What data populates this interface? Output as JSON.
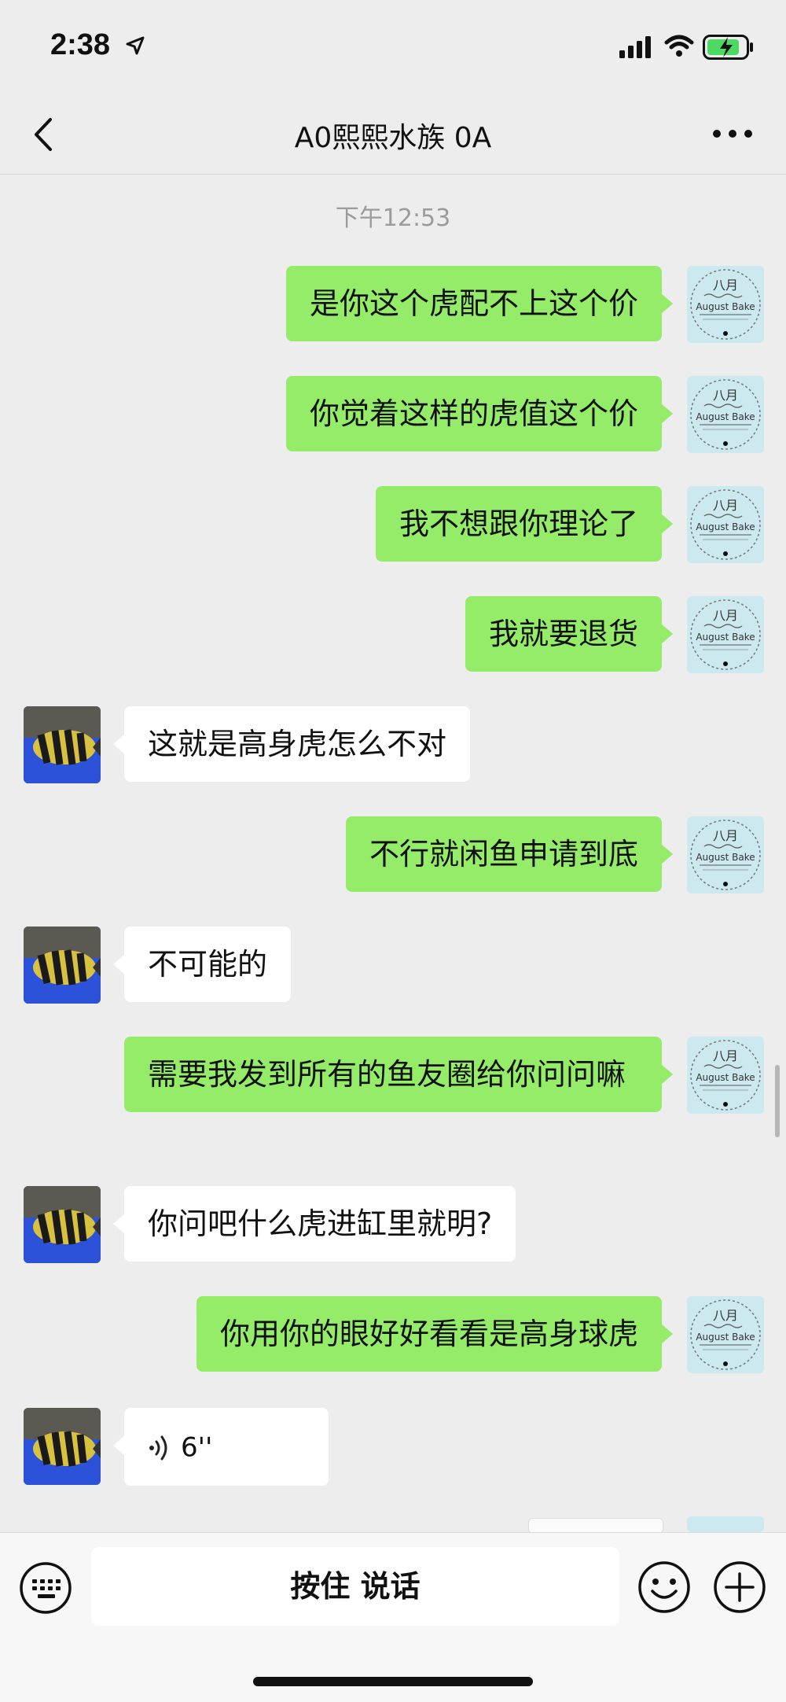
{
  "status": {
    "time": "2:38"
  },
  "nav": {
    "title": "A0熙熙水族 0A"
  },
  "chat": {
    "timestamp": "下午12:53",
    "messages": [
      {
        "side": "self",
        "text": "是你这个虎配不上这个价"
      },
      {
        "side": "self",
        "text": "你觉着这样的虎值这个价"
      },
      {
        "side": "self",
        "text": "我不想跟你理论了"
      },
      {
        "side": "self",
        "text": "我就要退货"
      },
      {
        "side": "other",
        "text": "这就是高身虎怎么不对"
      },
      {
        "side": "self",
        "text": "不行就闲鱼申请到底"
      },
      {
        "side": "other",
        "text": "不可能的"
      },
      {
        "side": "self",
        "text": "需要我发到所有的鱼友圈给你问问嘛"
      },
      {
        "side": "other",
        "text": "你问吧什么虎进缸里就明?"
      },
      {
        "side": "self",
        "text": "你用你的眼好好看看是高身球虎"
      },
      {
        "side": "other",
        "type": "voice",
        "text": "6''"
      }
    ],
    "self_avatar": {
      "line1": "八月",
      "line2": "August Bake"
    }
  },
  "input": {
    "hold_to_talk": "按住 说话"
  }
}
